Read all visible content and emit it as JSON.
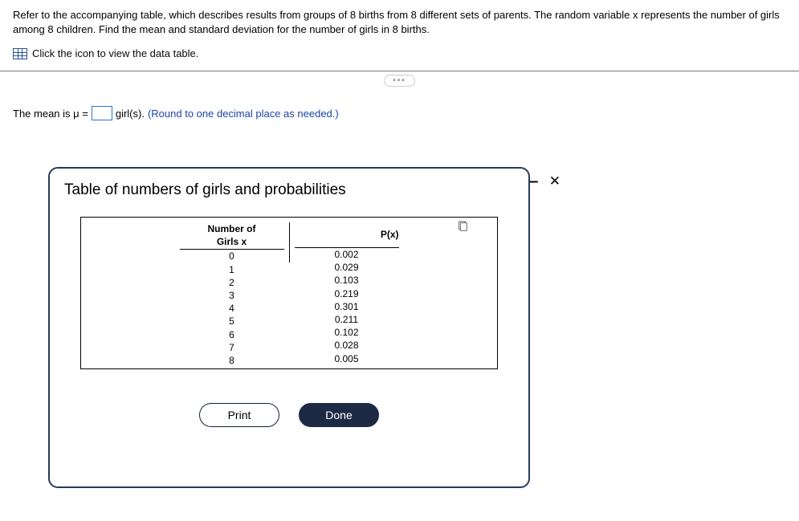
{
  "problem": {
    "text": "Refer to the accompanying table, which describes results from groups of 8 births from 8 different sets of parents. The random variable x represents the number of girls among 8 children. Find the mean and standard deviation for the number of girls in 8 births.",
    "link_text": "Click the icon to view the data table."
  },
  "answer": {
    "prefix": "The mean is μ = ",
    "suffix": " girl(s). ",
    "hint": "(Round to one decimal place as needed.)"
  },
  "dialog": {
    "title": "Table of numbers of girls and probabilities",
    "col1": {
      "head1": "Number of",
      "head2": "Girls x"
    },
    "col2": {
      "head": "P(x)"
    },
    "buttons": {
      "print": "Print",
      "done": "Done"
    }
  },
  "chart_data": {
    "type": "table",
    "title": "Table of numbers of girls and probabilities",
    "columns": [
      "Number of Girls x",
      "P(x)"
    ],
    "x": [
      0,
      1,
      2,
      3,
      4,
      5,
      6,
      7,
      8
    ],
    "p": [
      0.002,
      0.029,
      0.103,
      0.219,
      0.301,
      0.211,
      0.102,
      0.028,
      0.005
    ]
  }
}
